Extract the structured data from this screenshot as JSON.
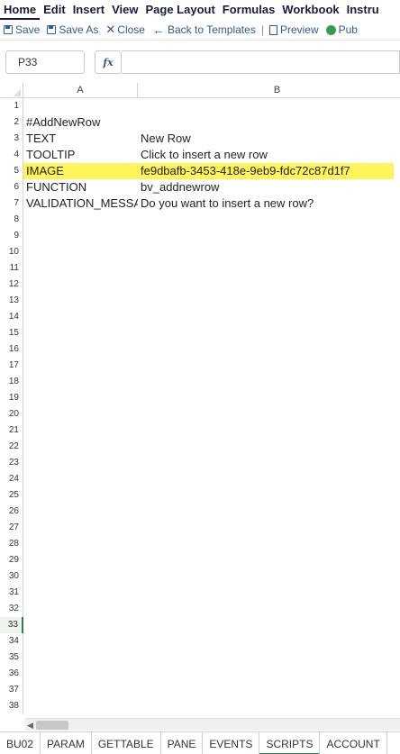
{
  "menu": {
    "items": [
      "Home",
      "Edit",
      "Insert",
      "View",
      "Page Layout",
      "Formulas",
      "Workbook",
      "Instru"
    ]
  },
  "toolbar": {
    "save": "Save",
    "save_as": "Save As",
    "close": "Close",
    "back": "Back to Templates",
    "separator": "|",
    "preview": "Preview",
    "publish": "Pub"
  },
  "formula_bar": {
    "name_box": "P33",
    "fx_label": "fx",
    "formula": ""
  },
  "grid": {
    "columns": [
      "A",
      "B"
    ],
    "selected_row": 33,
    "highlighted_row": 5,
    "rows": [
      {
        "num": "1",
        "a": "",
        "b": ""
      },
      {
        "num": "2",
        "a": "#AddNewRow",
        "b": ""
      },
      {
        "num": "3",
        "a": "TEXT",
        "b": "New Row"
      },
      {
        "num": "4",
        "a": "TOOLTIP",
        "b": "Click to insert a new row"
      },
      {
        "num": "5",
        "a": "IMAGE",
        "b": "fe9dbafb-3453-418e-9eb9-fdc72c87d1f7"
      },
      {
        "num": "6",
        "a": "FUNCTION",
        "b": "bv_addnewrow"
      },
      {
        "num": "7",
        "a": "VALIDATION_MESSAGE",
        "b": "Do you want to insert a new row?"
      },
      {
        "num": "8",
        "a": "",
        "b": ""
      },
      {
        "num": "9",
        "a": "",
        "b": ""
      },
      {
        "num": "10",
        "a": "",
        "b": ""
      },
      {
        "num": "11",
        "a": "",
        "b": ""
      },
      {
        "num": "12",
        "a": "",
        "b": ""
      },
      {
        "num": "13",
        "a": "",
        "b": ""
      },
      {
        "num": "14",
        "a": "",
        "b": ""
      },
      {
        "num": "15",
        "a": "",
        "b": ""
      },
      {
        "num": "16",
        "a": "",
        "b": ""
      },
      {
        "num": "17",
        "a": "",
        "b": ""
      },
      {
        "num": "18",
        "a": "",
        "b": ""
      },
      {
        "num": "19",
        "a": "",
        "b": ""
      },
      {
        "num": "20",
        "a": "",
        "b": ""
      },
      {
        "num": "21",
        "a": "",
        "b": ""
      },
      {
        "num": "22",
        "a": "",
        "b": ""
      },
      {
        "num": "23",
        "a": "",
        "b": ""
      },
      {
        "num": "24",
        "a": "",
        "b": ""
      },
      {
        "num": "25",
        "a": "",
        "b": ""
      },
      {
        "num": "26",
        "a": "",
        "b": ""
      },
      {
        "num": "27",
        "a": "",
        "b": ""
      },
      {
        "num": "28",
        "a": "",
        "b": ""
      },
      {
        "num": "29",
        "a": "",
        "b": ""
      },
      {
        "num": "30",
        "a": "",
        "b": ""
      },
      {
        "num": "31",
        "a": "",
        "b": ""
      },
      {
        "num": "32",
        "a": "",
        "b": ""
      },
      {
        "num": "33",
        "a": "",
        "b": ""
      },
      {
        "num": "34",
        "a": "",
        "b": ""
      },
      {
        "num": "35",
        "a": "",
        "b": ""
      },
      {
        "num": "36",
        "a": "",
        "b": ""
      },
      {
        "num": "37",
        "a": "",
        "b": ""
      },
      {
        "num": "38",
        "a": "",
        "b": ""
      }
    ]
  },
  "scrollbar": {
    "left_arrow": "◀"
  },
  "sheet_tabs": {
    "active": "SCRIPTS",
    "items": [
      "BU02",
      "PARAM",
      "GETTABLE",
      "PANE",
      "EVENTS",
      "SCRIPTS",
      "ACCOUNT"
    ]
  },
  "colors": {
    "highlight": "#fff55a",
    "menu_text": "#1a1a40",
    "toolbar_text": "#2e5a8e",
    "active_accent": "#2e7d4f"
  }
}
